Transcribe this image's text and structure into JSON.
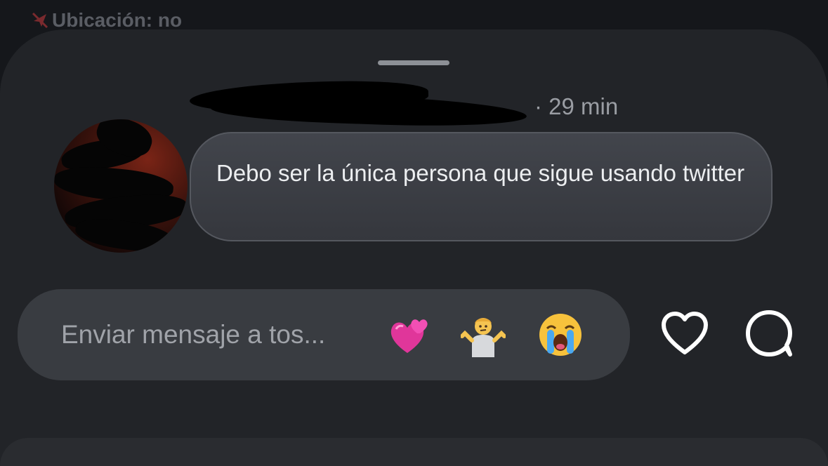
{
  "status": {
    "location_label": "Ubicación: no",
    "location_icon": "location-off-icon",
    "location_icon_color": "#7a2a2e"
  },
  "header": {
    "name_redacted": true,
    "separator": "·",
    "time": "29 min"
  },
  "message": {
    "text": "Debo ser la única persona que sigue usando twitter"
  },
  "composer": {
    "placeholder": "Enviar mensaje a tos...",
    "quick_reactions": [
      "two-hearts-emoji",
      "shrug-emoji",
      "crying-face-emoji"
    ]
  },
  "actions": {
    "like_icon": "heart-outline-icon",
    "reply_icon": "comment-bubble-icon"
  },
  "colors": {
    "background": "#15171b",
    "sheet": "#222428",
    "bubble": "#3a3d43",
    "composer": "#393c41",
    "text_primary": "#eceef0",
    "text_secondary": "#9a9da3"
  }
}
